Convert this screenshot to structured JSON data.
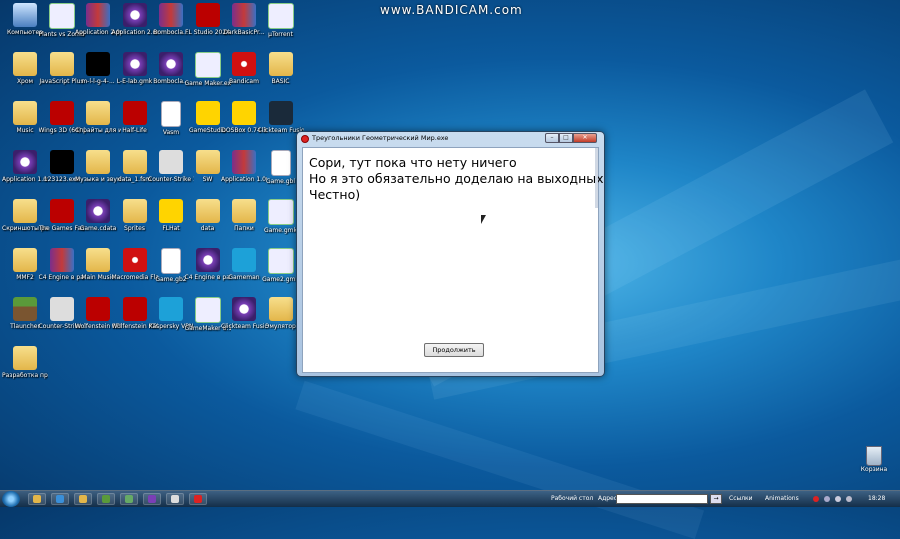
{
  "watermark": "www.BANDICAM.com",
  "desktop_icons": [
    {
      "label": "Компьютер",
      "type": "pc"
    },
    {
      "label": "Plants vs Zombies",
      "type": "green"
    },
    {
      "label": "Application 2.001",
      "type": "rar"
    },
    {
      "label": "Application 2.mfa",
      "type": "app"
    },
    {
      "label": "Bombocla...",
      "type": "rar"
    },
    {
      "label": "FL Studio 2024",
      "type": "red"
    },
    {
      "label": "DarkBasicPr...",
      "type": "rar"
    },
    {
      "label": "µTorrent",
      "type": "green"
    },
    {
      "label": "Хром",
      "type": "folder"
    },
    {
      "label": "JavaScript Plus",
      "type": "folder"
    },
    {
      "label": "m-l-l-g-4-...",
      "type": "black"
    },
    {
      "label": "L-E-lab.gmk",
      "type": "app"
    },
    {
      "label": "Bombocla...",
      "type": "app"
    },
    {
      "label": "Game Maker.exe",
      "type": "green"
    },
    {
      "label": "Bandicam",
      "type": "flash"
    },
    {
      "label": "BASIC",
      "type": "folder"
    },
    {
      "label": "Music",
      "type": "folder"
    },
    {
      "label": "Wings 3D (64) 2.4.1",
      "type": "red"
    },
    {
      "label": "Спрайты для игры",
      "type": "folder"
    },
    {
      "label": "Half-Life",
      "type": "red"
    },
    {
      "label": "Vasm",
      "type": "file"
    },
    {
      "label": "GameStudio",
      "type": "yellow"
    },
    {
      "label": "DOSBox 0.74-3",
      "type": "yellow"
    },
    {
      "label": "Clickteam Fusion...",
      "type": "steam"
    },
    {
      "label": "Application 1.mfa",
      "type": "app"
    },
    {
      "label": "123123.exe",
      "type": "black"
    },
    {
      "label": "Музыка и звуки...",
      "type": "folder"
    },
    {
      "label": "data_1.fsm",
      "type": "folder"
    },
    {
      "label": "Counter-Strike 1.6",
      "type": "cs"
    },
    {
      "label": "SW",
      "type": "folder"
    },
    {
      "label": "Application 1.001",
      "type": "rar"
    },
    {
      "label": "Game.gbl",
      "type": "file"
    },
    {
      "label": "Скриншоты разработки",
      "type": "folder"
    },
    {
      "label": "The Games Factory 2",
      "type": "red"
    },
    {
      "label": "Game.cdata",
      "type": "app"
    },
    {
      "label": "Sprites",
      "type": "folder"
    },
    {
      "label": "FLHat",
      "type": "yellow"
    },
    {
      "label": "data",
      "type": "folder"
    },
    {
      "label": "Папки",
      "type": "folder"
    },
    {
      "label": "Game.gmk",
      "type": "green"
    },
    {
      "label": "MMF2",
      "type": "folder"
    },
    {
      "label": "C4 Engine в разработке",
      "type": "rar"
    },
    {
      "label": "Main Music",
      "type": "folder"
    },
    {
      "label": "Macromedia Flash 8",
      "type": "flash"
    },
    {
      "label": "Game.gb2",
      "type": "file"
    },
    {
      "label": "C4 Engine в разработке",
      "type": "app"
    },
    {
      "label": "Gameman",
      "type": "blue"
    },
    {
      "label": "Game2.gmk",
      "type": "green"
    },
    {
      "label": "Tlauncher",
      "type": "mc"
    },
    {
      "label": "Counter-Strike 1.6",
      "type": "cs"
    },
    {
      "label": "Wolfenstein RTCW (Sp...",
      "type": "red"
    },
    {
      "label": "Wolfenstein RTCW (M...",
      "type": "red"
    },
    {
      "label": "Kaspersky VPN",
      "type": "blue"
    },
    {
      "label": "GameMaker 8.1.141 W...",
      "type": "green"
    },
    {
      "label": "Clickteam Fusion 2.5 Dev",
      "type": "app"
    },
    {
      "label": "Эмулятор",
      "type": "folder"
    },
    {
      "label": "Разработка программ С...",
      "type": "folder"
    }
  ],
  "dialog": {
    "title": "Треугольники Геометрический Мир.exe",
    "message": "Сори, тут пока что нету ничего\nНо я это обязательно доделаю на выходных\nЧестно)",
    "button": "Продолжить",
    "btn_min": "–",
    "btn_max": "□",
    "btn_close": "✕"
  },
  "recycle_bin": {
    "label": "Корзина"
  },
  "taskbar": {
    "desktop_label": "Рабочий стол",
    "address_label": "Адрес",
    "address_value": "",
    "go_label": "→",
    "links_label": "Ссылки",
    "animations_label": "Animations",
    "clock": "18:28",
    "items": [
      {
        "icon": "folder-icon",
        "color": "#e3b64a"
      },
      {
        "icon": "ie-icon",
        "color": "#3a8fd8"
      },
      {
        "icon": "explorer-icon",
        "color": "#e3b64a"
      },
      {
        "icon": "gamemaker-icon",
        "color": "#5a9a3a"
      },
      {
        "icon": "gear-icon",
        "color": "#6a6"
      },
      {
        "icon": "app-icon",
        "color": "#7a3fb6"
      },
      {
        "icon": "window-icon",
        "color": "#ddd"
      },
      {
        "icon": "record-icon",
        "color": "#d22"
      }
    ]
  }
}
